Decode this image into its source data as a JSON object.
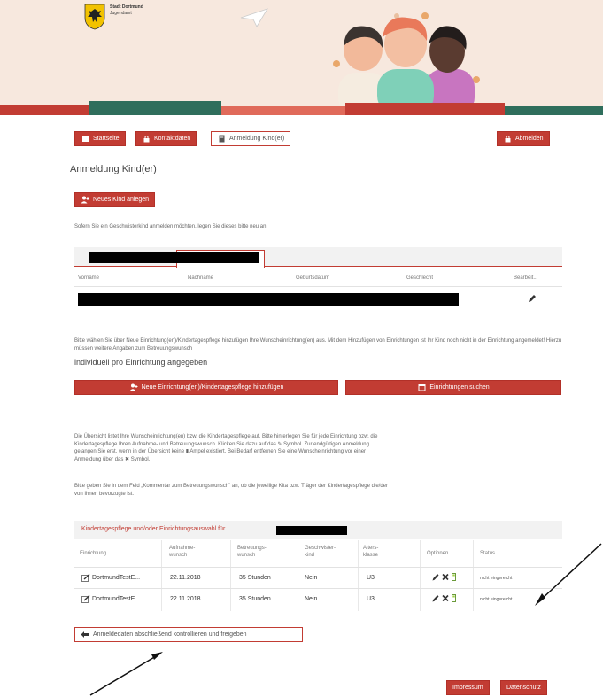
{
  "header": {
    "city_name": "Stadt Dortmund",
    "city_sub": "Jugendamt"
  },
  "nav": {
    "startseite": "Startseite",
    "kontaktdaten": "Kontaktdaten",
    "anmeldung": "Anmeldung Kind(er)",
    "abmelden": "Abmelden"
  },
  "page": {
    "title": "Anmeldung Kind(er)",
    "new_child_button": "Neues Kind anlegen",
    "sibling_hint": "Sofern Sie ein Geschwisterkind anmelden möchten, legen Sie dieses bitte neu an."
  },
  "children_table": {
    "columns": [
      "Vorname",
      "Nachname",
      "Geburtsdatum",
      "Geschlecht",
      "Bearbeit..."
    ]
  },
  "selection": {
    "instruction_1": "Bitte wählen Sie über Neue Einrichtung(en)/Kindertagespflege hinzufügen Ihre Wunscheinrichtung(en) aus. Mit dem Hinzufügen von Einrichtungen ist Ihr Kind noch nicht in der Einrichtung angemeldet! Hierzu müssen weitere Angaben zum Betreuungswunsch",
    "instruction_2": "individuell pro Einrichtung angegeben",
    "add_button": "Neue Einrichtung(en)/Kindertagespflege hinzufügen",
    "search_button": "Einrichtungen suchen"
  },
  "overview": {
    "paragraph_1_a": "Die Übersicht listet Ihre Wunscheinrichtung(en) bzw. die Kindertagespflege auf. Bitte hinterlegen Sie für jede Einrichtung bzw. die",
    "paragraph_1_b": "Kindertagespflege Ihren Aufnahme- und Betreuungswunsch. Klicken Sie dazu auf das ✎ Symbol. Zur endgültigen Anmeldung",
    "paragraph_1_c": "gelangen Sie erst, wenn in der Übersicht keine ▮ Ampel existiert. Bei Bedarf entfernen Sie eine Wunscheinrichtung vor einer",
    "paragraph_1_d": "Anmeldung über das ✖ Symbol.",
    "paragraph_2_a": "Bitte geben Sie in dem Feld „Kommentar zum Betreuungswunsch\" an, ob die jeweilige Kita bzw. Träger der Kindertagespflege die/der",
    "paragraph_2_b": "von Ihnen bevorzugte ist."
  },
  "facility_table": {
    "title": "Kindertagespflege und/oder Einrichtungsauswahl für",
    "columns": {
      "einrichtung": "Einrichtung",
      "aufnahme": "Aufnahme-\nwunsch",
      "betreuung": "Betreuungs-\nwunsch",
      "geschwister": "Geschwister-\nkind",
      "alter": "Alters-\nklasse",
      "optionen": "Optionen",
      "status": "Status"
    },
    "rows": [
      {
        "name": "DortmundTestE...",
        "aufnahme": "22.11.2018",
        "betreuung": "35 Stunden",
        "geschwister": "Nein",
        "alter": "U3",
        "status": "nicht eingereicht"
      },
      {
        "name": "DortmundTestE...",
        "aufnahme": "22.11.2018",
        "betreuung": "35 Stunden",
        "geschwister": "Nein",
        "alter": "U3",
        "status": "nicht eingereicht"
      }
    ]
  },
  "actions": {
    "submit_button": "Anmeldedaten abschließend kontrollieren und freigeben"
  },
  "footer": {
    "impressum": "Impressum",
    "datenschutz": "Datenschutz"
  },
  "colors": {
    "accent": "#c23c33",
    "banner_bg": "#f7e8de"
  }
}
